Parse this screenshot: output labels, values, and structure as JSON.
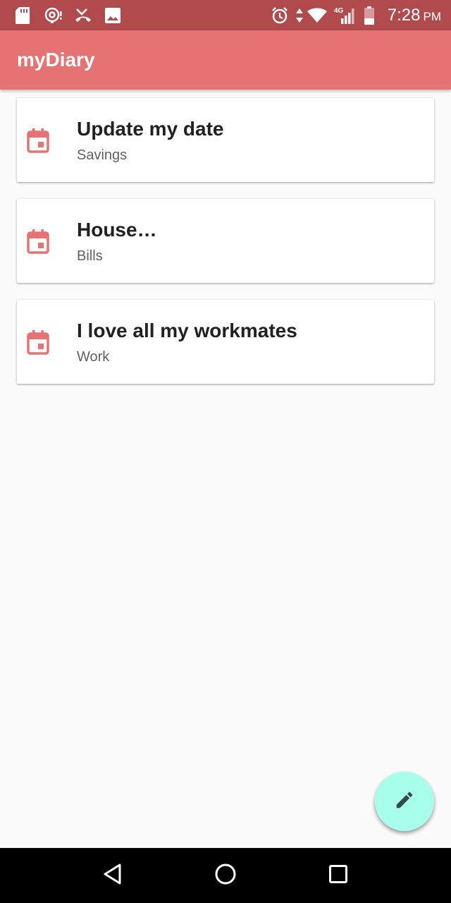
{
  "status_bar": {
    "time": "7:28",
    "ampm": "PM",
    "network": "4G",
    "icons": [
      "sd-card-icon",
      "hotspot-icon",
      "missed-call-icon",
      "image-icon",
      "alarm-icon",
      "data-arrows-icon",
      "wifi-icon",
      "signal-icon",
      "battery-icon"
    ],
    "color": "#b14a4d"
  },
  "app_bar": {
    "title": "myDiary",
    "color": "#e57373"
  },
  "entries": [
    {
      "title": "Update my date",
      "category": "Savings",
      "icon": "calendar-icon"
    },
    {
      "title": "House…",
      "category": "Bills",
      "icon": "calendar-icon"
    },
    {
      "title": "I love all my workmates",
      "category": "Work",
      "icon": "calendar-icon"
    }
  ],
  "fab": {
    "icon": "pencil-icon",
    "color": "#a7ffeb"
  },
  "nav_bar": {
    "buttons": [
      "back-icon",
      "home-icon",
      "recents-icon"
    ]
  },
  "colors": {
    "accent": "#e57373",
    "background": "#fafafa"
  }
}
